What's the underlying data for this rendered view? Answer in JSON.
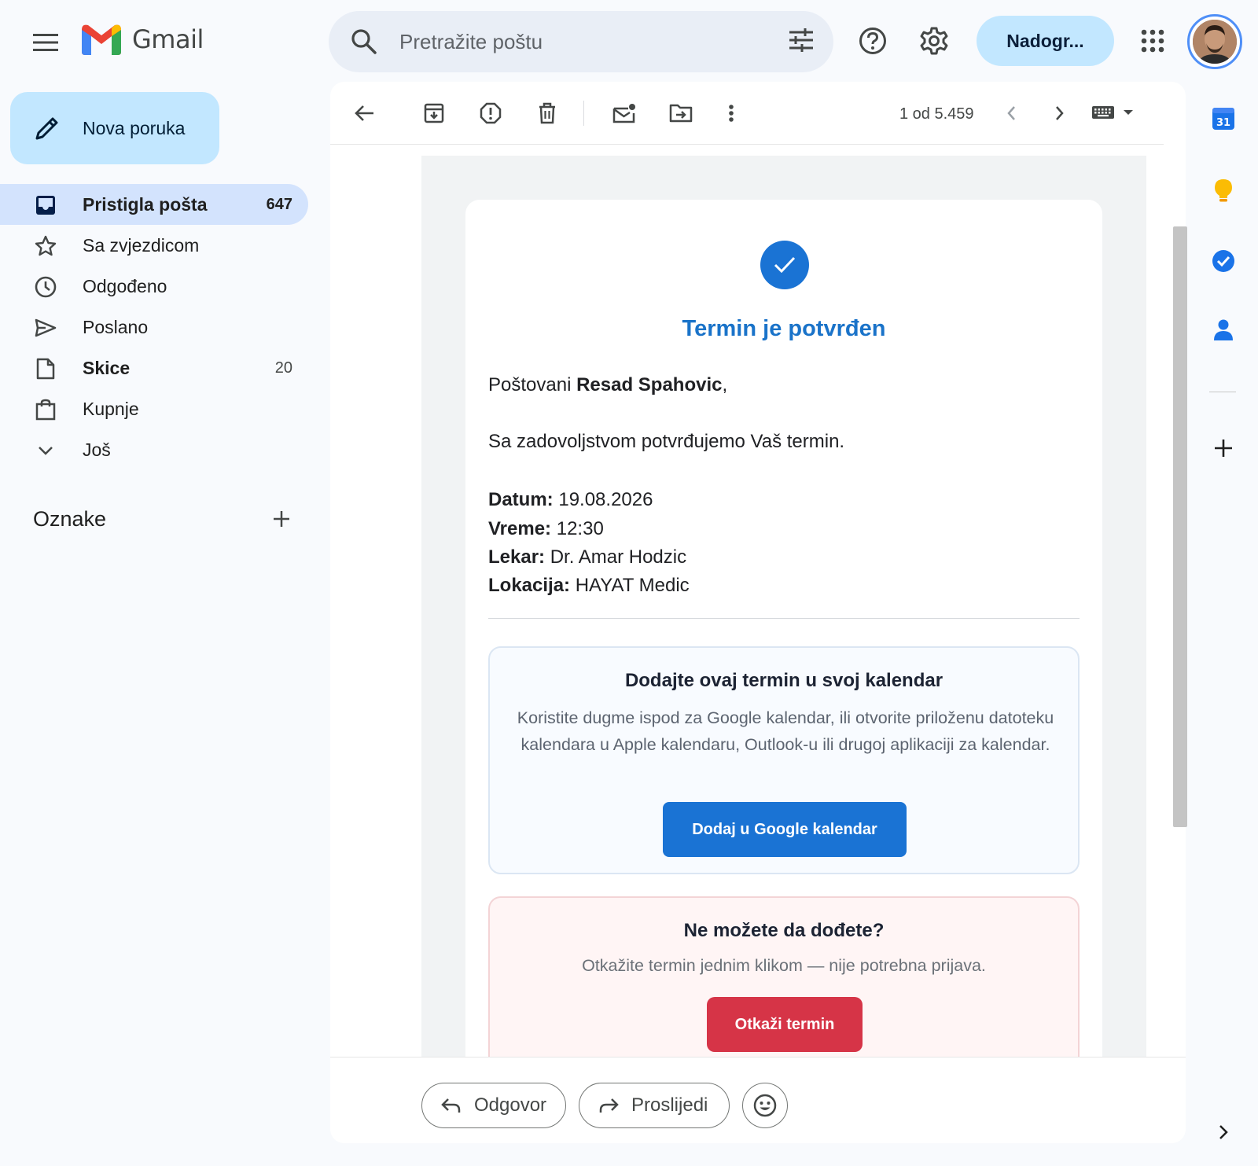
{
  "app": {
    "name": "Gmail"
  },
  "search": {
    "placeholder": "Pretražite poštu"
  },
  "header": {
    "upgrade_label": "Nadogr..."
  },
  "compose": {
    "label": "Nova poruka"
  },
  "sidebar": {
    "items": [
      {
        "label": "Pristigla pošta",
        "count": "647",
        "icon": "inbox-icon"
      },
      {
        "label": "Sa zvjezdicom",
        "count": "",
        "icon": "star-icon"
      },
      {
        "label": "Odgođeno",
        "count": "",
        "icon": "clock-icon"
      },
      {
        "label": "Poslano",
        "count": "",
        "icon": "send-icon"
      },
      {
        "label": "Skice",
        "count": "20",
        "icon": "draft-icon"
      },
      {
        "label": "Kupnje",
        "count": "",
        "icon": "shopping-bag-icon"
      },
      {
        "label": "Još",
        "count": "",
        "icon": "chevron-down-icon"
      }
    ],
    "labels_title": "Oznake"
  },
  "toolbar": {
    "pager": "1 od 5.459"
  },
  "email": {
    "title": "Termin je potvrđen",
    "greeting_prefix": "Poštovani ",
    "recipient": "Resad Spahovic",
    "greeting_suffix": ",",
    "intro": "Sa zadovoljstvom potvrđujemo Vaš termin.",
    "details": [
      {
        "label": "Datum:",
        "value": "19.08.2026"
      },
      {
        "label": "Vreme:",
        "value": "12:30"
      },
      {
        "label": "Lekar:",
        "value": "Dr. Amar Hodzic"
      },
      {
        "label": "Lokacija:",
        "value": "HAYAT Medic"
      }
    ],
    "calendar": {
      "title": "Dodajte ovaj termin u svoj kalendar",
      "description": "Koristite dugme ispod za Google kalendar, ili otvorite priloženu datoteku kalendara u Apple kalendaru, Outlook-u ili drugoj aplikaciji za kalendar.",
      "button": "Dodaj u Google kalendar"
    },
    "cancel": {
      "title": "Ne možete da dođete?",
      "description": "Otkažite termin jednim klikom — nije potrebna prijava.",
      "button": "Otkaži termin"
    }
  },
  "reply": {
    "reply_label": "Odgovor",
    "forward_label": "Proslijedi"
  },
  "right_rail": {
    "calendar_day": "31"
  },
  "colors": {
    "accent": "#1a73d4",
    "nav_active": "#d3e3fd",
    "compose_bg": "#c2e7ff",
    "cancel_button": "#d63447",
    "title_blue": "#1a73c9"
  }
}
